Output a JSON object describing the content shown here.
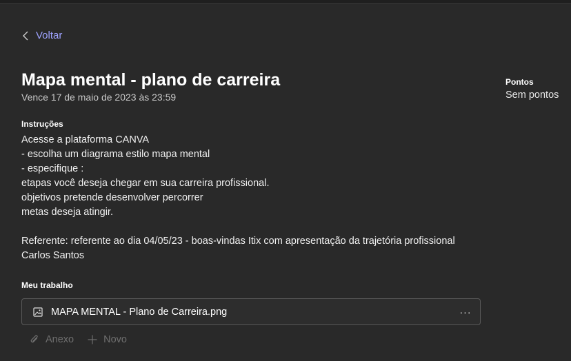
{
  "nav": {
    "back_label": "Voltar"
  },
  "assignment": {
    "title": "Mapa mental - plano de carreira",
    "due": "Vence 17 de maio de 2023 às 23:59"
  },
  "points": {
    "label": "Pontos",
    "value": "Sem pontos"
  },
  "instructions": {
    "label": "Instruções",
    "lines": [
      "Acesse a plataforma CANVA",
      "- escolha um diagrama estilo mapa mental",
      "- especifique :",
      "etapas você deseja chegar em sua carreira profissional.",
      "objetivos pretende desenvolver percorrer",
      "metas deseja atingir.",
      "",
      "Referente: referente ao dia 04/05/23 - boas-vindas Itix com apresentação da trajetória profissional",
      "Carlos Santos"
    ]
  },
  "my_work": {
    "label": "Meu trabalho",
    "file_name": "MAPA MENTAL - Plano de Carreira.png",
    "more_label": "···"
  },
  "actions": {
    "attach_label": "Anexo",
    "new_label": "Novo"
  },
  "colors": {
    "accent": "#9ea2ff",
    "background": "#292929",
    "disabled": "#6f6f6f"
  }
}
